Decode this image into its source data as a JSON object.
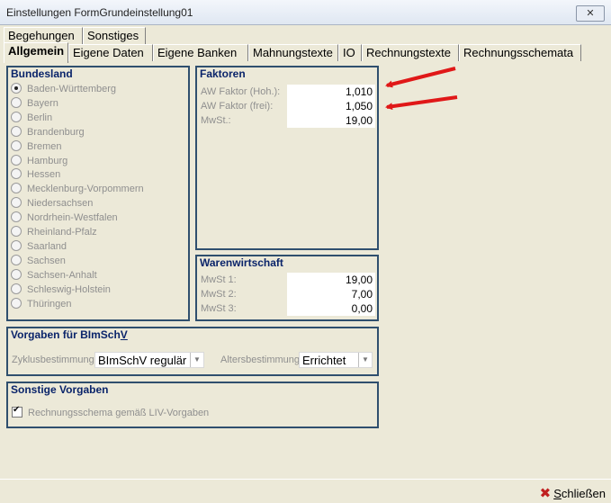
{
  "window": {
    "title": "Einstellungen FormGrundeinstellung01",
    "close_glyph": "✕"
  },
  "tabs_top": [
    {
      "label": "Begehungen"
    },
    {
      "label": "Sonstiges"
    }
  ],
  "tabs_main": [
    {
      "label": "Allgemein",
      "active": true
    },
    {
      "label": "Eigene Daten"
    },
    {
      "label": "Eigene Banken"
    },
    {
      "label": "Mahnungstexte"
    },
    {
      "label": "IO"
    },
    {
      "label": "Rechnungstexte"
    },
    {
      "label": "Rechnungsschemata"
    }
  ],
  "bundesland": {
    "title": "Bundesland",
    "selected_index": 0,
    "options": [
      "Baden-Württemberg",
      "Bayern",
      "Berlin",
      "Brandenburg",
      "Bremen",
      "Hamburg",
      "Hessen",
      "Mecklenburg-Vorpommern",
      "Niedersachsen",
      "Nordrhein-Westfalen",
      "Rheinland-Pfalz",
      "Saarland",
      "Sachsen",
      "Sachsen-Anhalt",
      "Schleswig-Holstein",
      "Thüringen"
    ]
  },
  "faktoren": {
    "title": "Faktoren",
    "rows": [
      {
        "label": "AW Faktor (Hoh.):",
        "value": "1,010"
      },
      {
        "label": "AW Faktor (frei):",
        "value": "1,050"
      },
      {
        "label": "MwSt.:",
        "value": "19,00"
      }
    ]
  },
  "warenwirtschaft": {
    "title": "Warenwirtschaft",
    "rows": [
      {
        "label": "MwSt 1:",
        "value": "19,00"
      },
      {
        "label": "MwSt 2:",
        "value": "7,00"
      },
      {
        "label": "MwSt 3:",
        "value": "0,00"
      }
    ]
  },
  "vorgaben": {
    "title_pre": "Vorgaben für BImSch",
    "title_ul": "V",
    "zyklus_label": "Zyklusbestimmung",
    "zyklus_value": "BImSchV regulär",
    "alter_label": "Altersbestimmung",
    "alter_value": "Errichtet"
  },
  "sonstige": {
    "title": "Sonstige Vorgaben",
    "checkbox_label": "Rechnungsschema gemäß LIV-Vorgaben",
    "checked": true
  },
  "footer": {
    "close_pre": "",
    "close_ul": "S",
    "close_post": "chließen"
  },
  "colors": {
    "annotation_arrow": "#e01818",
    "group_border": "#2f4f6e",
    "group_title": "#0a246a"
  }
}
